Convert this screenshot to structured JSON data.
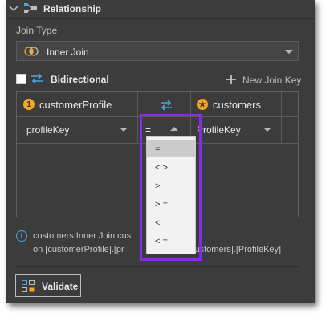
{
  "header": {
    "title": "Relationship",
    "icon": "relationship-icon"
  },
  "join_type": {
    "label": "Join Type",
    "value": "Inner Join",
    "icon": "inner-join-venn-icon"
  },
  "bidirectional": {
    "checked": false,
    "label": "Bidirectional",
    "icon": "bidirectional-arrows-icon"
  },
  "new_join_key": {
    "label": "New Join Key",
    "icon": "plus-icon"
  },
  "grid": {
    "left_table": {
      "badge": "1",
      "name": "customerProfile"
    },
    "right_table": {
      "badge": "★",
      "name": "customers"
    },
    "swap_icon": "swap-arrows-icon",
    "row": {
      "left_value": "profileKey",
      "operator": "=",
      "right_value": "ProfileKey"
    }
  },
  "operator_options": [
    "=",
    "< >",
    ">",
    "> =",
    "<",
    "< ="
  ],
  "selected_operator_index": 0,
  "info": {
    "line1": "customers Inner Join cus",
    "line2_left": "on [customerProfile].[pr",
    "line2_right": "customers].[ProfileKey]"
  },
  "validate": {
    "label": "Validate",
    "icon": "validate-icon"
  },
  "colors": {
    "panel": "#3c3c3c",
    "accent_orange": "#f5a623",
    "accent_blue": "#4aa3df",
    "highlight": "#8a2be2"
  }
}
